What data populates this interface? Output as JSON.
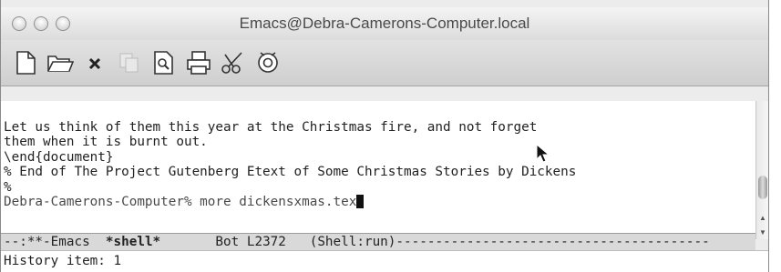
{
  "window": {
    "title": "Emacs@Debra-Camerons-Computer.local"
  },
  "toolbar": {
    "icons": [
      "new-file-icon",
      "open-folder-icon",
      "close-icon",
      "copy-icon",
      "search-icon",
      "print-icon",
      "cut-icon",
      "settings-icon"
    ]
  },
  "editor": {
    "lines": [
      "Let us think of them this year at the Christmas fire, and not forget",
      "them when it is burnt out.",
      "\\end{document}",
      "% End of The Project Gutenberg Etext of Some Christmas Stories by Dickens",
      "%"
    ],
    "prompt": "Debra-Camerons-Computer% more dickensxmas.tex"
  },
  "modeline": {
    "prefix": "--:**-Emacs  ",
    "buffer": "*shell*",
    "position": "       Bot L2372   ",
    "mode": "(Shell:run)",
    "suffix": "----------------------------------------"
  },
  "minibuffer": {
    "text": "History item: 1"
  }
}
